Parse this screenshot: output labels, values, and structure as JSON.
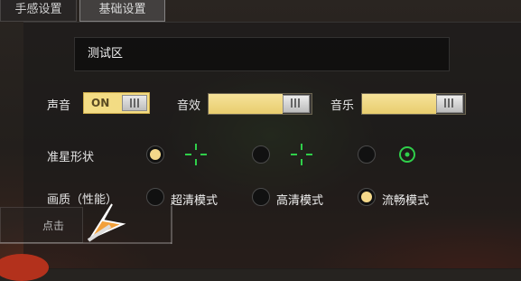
{
  "tabs": [
    {
      "label": "手感设置",
      "active": false
    },
    {
      "label": "基础设置",
      "active": true
    }
  ],
  "test_area": {
    "label": "测试区"
  },
  "sound": {
    "label": "声音",
    "toggle_label": "ON",
    "effect_label": "音效",
    "effect_level": 0.72,
    "music_label": "音乐",
    "music_level": 0.72
  },
  "crosshair": {
    "label": "准星形状",
    "options": [
      {
        "icon": "crosshair-dashed-green-icon",
        "selected": true
      },
      {
        "icon": "crosshair-dashed-green-icon",
        "selected": false
      },
      {
        "icon": "crosshair-circle-dot-green-icon",
        "selected": false
      }
    ]
  },
  "quality": {
    "label": "画质（性能）",
    "options": [
      {
        "label": "超清模式",
        "selected": false
      },
      {
        "label": "高清模式",
        "selected": false
      },
      {
        "label": "流畅模式",
        "selected": true
      }
    ]
  },
  "overlay": {
    "click_label": "点击"
  },
  "colors": {
    "accent": "#f3dc84",
    "crosshair": "#2fcf4a",
    "panel": "#1c1a1a"
  }
}
